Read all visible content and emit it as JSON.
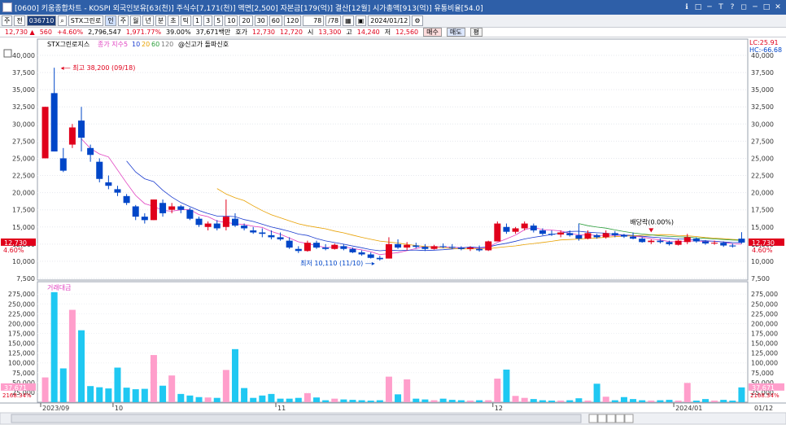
{
  "window": {
    "title": "[0600] 키움종합차트 - KOSPI 외국인보유[63(천)] 주식수[7,171(천)] 액면[2,500] 자본금[179(억)] 결산[12월] 시가총액[913(억)] 유통비율[54.0]",
    "buttons": [
      "ℹ",
      "□",
      "─",
      "T",
      "?",
      "◻",
      "─",
      "□",
      "✕"
    ]
  },
  "toolbar": {
    "period": "주",
    "mode": "전",
    "code": "036710",
    "stock_name": "STX그린로",
    "sel_label": "인",
    "tabs": [
      "주",
      "월",
      "년",
      "분",
      "초",
      "틱"
    ],
    "minutes": [
      "1",
      "3",
      "5",
      "10",
      "20",
      "30",
      "60",
      "120"
    ],
    "count": "78",
    "count_total": "/78",
    "date": "2024/01/12"
  },
  "quote": {
    "price": "12,730 ▲",
    "change": "560",
    "change_pct": "+4.60%",
    "volume": "2,796,547",
    "volume2": "1,971.77%",
    "ratio": "39.00%",
    "amount": "37,671백만",
    "hoga_label": "호가",
    "ask": "12,730",
    "bid": "12,720",
    "open_label": "시",
    "open": "13,300",
    "high_label": "고",
    "high": "14,240",
    "low_label": "저",
    "low": "12,560",
    "buy_label": "매수",
    "sell_label": "매도",
    "extra_label": "평"
  },
  "legend": {
    "name": "STX그린로지스",
    "ma_label": "종가 지수",
    "ma": [
      "5",
      "10",
      "20",
      "60",
      "120"
    ],
    "ma_colors": [
      "#e040c0",
      "#1c3dcf",
      "#e8a000",
      "#2a9d3a",
      "#777777"
    ],
    "signal": "@신고가 돌파신호"
  },
  "annotations": {
    "high": "최고 38,200 (09/18)",
    "low": "최저 10,110 (11/10)",
    "event": "배당락(0.00%)",
    "lc": "LC:25.91",
    "hc": "HC:-66.68"
  },
  "price_axis": {
    "labels": [
      "40,000",
      "37,500",
      "35,000",
      "32,500",
      "30,000",
      "27,500",
      "25,000",
      "22,500",
      "20,000",
      "17,500",
      "15,000",
      "12,500",
      "10,000",
      "7,500"
    ],
    "current": "12,730",
    "current_pct": "4.60%"
  },
  "volume_axis": {
    "title": "거래대금",
    "labels": [
      "275,000",
      "250,000",
      "225,000",
      "200,000",
      "175,000",
      "150,000",
      "125,000",
      "100,000",
      "75,000",
      "50,000",
      "25,000"
    ],
    "current": "37,671",
    "current_pct": "2168.34%"
  },
  "date_axis": {
    "labels": [
      "2023/09",
      "10",
      "11",
      "12",
      "2024/01"
    ],
    "right": "01/12"
  },
  "chart_data": {
    "type": "candlestick",
    "ylim": [
      7500,
      40000
    ],
    "candles": [
      {
        "o": 25000,
        "h": 32500,
        "l": 25000,
        "c": 32500,
        "v": 63000
      },
      {
        "o": 34500,
        "h": 38200,
        "l": 26000,
        "c": 26000,
        "v": 280000
      },
      {
        "o": 25000,
        "h": 26500,
        "l": 23000,
        "c": 23200,
        "v": 86000
      },
      {
        "o": 27000,
        "h": 30000,
        "l": 26500,
        "c": 29500,
        "v": 235000
      },
      {
        "o": 30500,
        "h": 32500,
        "l": 26000,
        "c": 28000,
        "v": 183000
      },
      {
        "o": 26500,
        "h": 27000,
        "l": 24500,
        "c": 25500,
        "v": 41000
      },
      {
        "o": 24500,
        "h": 25000,
        "l": 21500,
        "c": 22000,
        "v": 38000
      },
      {
        "o": 21500,
        "h": 22500,
        "l": 20500,
        "c": 21000,
        "v": 35000
      },
      {
        "o": 20500,
        "h": 21000,
        "l": 19500,
        "c": 20000,
        "v": 88000
      },
      {
        "o": 19500,
        "h": 19800,
        "l": 18200,
        "c": 18500,
        "v": 37000
      },
      {
        "o": 18000,
        "h": 18200,
        "l": 16000,
        "c": 16500,
        "v": 33000
      },
      {
        "o": 16500,
        "h": 17000,
        "l": 15500,
        "c": 16000,
        "v": 34000
      },
      {
        "o": 16000,
        "h": 19000,
        "l": 16000,
        "c": 19000,
        "v": 120000
      },
      {
        "o": 18500,
        "h": 19000,
        "l": 16500,
        "c": 17000,
        "v": 42000
      },
      {
        "o": 17500,
        "h": 18500,
        "l": 17000,
        "c": 18000,
        "v": 68000
      },
      {
        "o": 18000,
        "h": 18200,
        "l": 17000,
        "c": 17500,
        "v": 21000
      },
      {
        "o": 17500,
        "h": 17800,
        "l": 16000,
        "c": 16200,
        "v": 17000
      },
      {
        "o": 16200,
        "h": 16500,
        "l": 15000,
        "c": 15300,
        "v": 13000
      },
      {
        "o": 15000,
        "h": 15800,
        "l": 14500,
        "c": 15500,
        "v": 12000
      },
      {
        "o": 15500,
        "h": 16000,
        "l": 14500,
        "c": 14800,
        "v": 11000
      },
      {
        "o": 15000,
        "h": 19000,
        "l": 14500,
        "c": 16500,
        "v": 82000
      },
      {
        "o": 16200,
        "h": 17000,
        "l": 15000,
        "c": 15200,
        "v": 135000
      },
      {
        "o": 15200,
        "h": 15500,
        "l": 14500,
        "c": 14800,
        "v": 36000
      },
      {
        "o": 14500,
        "h": 15000,
        "l": 14000,
        "c": 14200,
        "v": 11000
      },
      {
        "o": 14200,
        "h": 14800,
        "l": 13500,
        "c": 14000,
        "v": 17000
      },
      {
        "o": 13800,
        "h": 14500,
        "l": 13200,
        "c": 13500,
        "v": 21000
      },
      {
        "o": 13500,
        "h": 14200,
        "l": 13000,
        "c": 13200,
        "v": 9000
      },
      {
        "o": 13000,
        "h": 13500,
        "l": 11800,
        "c": 12000,
        "v": 9000
      },
      {
        "o": 11800,
        "h": 12200,
        "l": 11200,
        "c": 11500,
        "v": 11000
      },
      {
        "o": 11500,
        "h": 13000,
        "l": 11400,
        "c": 12700,
        "v": 23000
      },
      {
        "o": 12700,
        "h": 13000,
        "l": 11800,
        "c": 12000,
        "v": 12000
      },
      {
        "o": 12000,
        "h": 12500,
        "l": 11600,
        "c": 11800,
        "v": 5000
      },
      {
        "o": 11800,
        "h": 12600,
        "l": 11700,
        "c": 12400,
        "v": 9000
      },
      {
        "o": 12200,
        "h": 12500,
        "l": 11600,
        "c": 11800,
        "v": 7000
      },
      {
        "o": 11800,
        "h": 12000,
        "l": 11200,
        "c": 11300,
        "v": 6000
      },
      {
        "o": 11300,
        "h": 11600,
        "l": 10800,
        "c": 11000,
        "v": 5000
      },
      {
        "o": 11000,
        "h": 11300,
        "l": 10400,
        "c": 10500,
        "v": 4000
      },
      {
        "o": 10500,
        "h": 10800,
        "l": 10110,
        "c": 10300,
        "v": 5000
      },
      {
        "o": 10400,
        "h": 13500,
        "l": 10400,
        "c": 12500,
        "v": 65000
      },
      {
        "o": 12500,
        "h": 13200,
        "l": 11800,
        "c": 12000,
        "v": 20000
      },
      {
        "o": 12000,
        "h": 12800,
        "l": 11600,
        "c": 12400,
        "v": 58000
      },
      {
        "o": 12300,
        "h": 12700,
        "l": 11900,
        "c": 12100,
        "v": 9000
      },
      {
        "o": 12100,
        "h": 12500,
        "l": 11500,
        "c": 11800,
        "v": 7000
      },
      {
        "o": 11800,
        "h": 12400,
        "l": 11700,
        "c": 12200,
        "v": 5000
      },
      {
        "o": 12200,
        "h": 12600,
        "l": 11900,
        "c": 12100,
        "v": 9000
      },
      {
        "o": 12100,
        "h": 12500,
        "l": 11800,
        "c": 12000,
        "v": 6000
      },
      {
        "o": 12000,
        "h": 12200,
        "l": 11600,
        "c": 11800,
        "v": 5000
      },
      {
        "o": 11800,
        "h": 12200,
        "l": 11500,
        "c": 12000,
        "v": 4000
      },
      {
        "o": 11800,
        "h": 12300,
        "l": 11400,
        "c": 11600,
        "v": 5000
      },
      {
        "o": 11600,
        "h": 13000,
        "l": 11500,
        "c": 12900,
        "v": 5000
      },
      {
        "o": 12900,
        "h": 15800,
        "l": 12900,
        "c": 15500,
        "v": 60000
      },
      {
        "o": 15000,
        "h": 15500,
        "l": 14000,
        "c": 14300,
        "v": 83000
      },
      {
        "o": 14300,
        "h": 15000,
        "l": 14000,
        "c": 14800,
        "v": 16000
      },
      {
        "o": 14800,
        "h": 15800,
        "l": 14500,
        "c": 15500,
        "v": 11000
      },
      {
        "o": 15200,
        "h": 15500,
        "l": 14200,
        "c": 14500,
        "v": 8000
      },
      {
        "o": 14500,
        "h": 14800,
        "l": 13800,
        "c": 14000,
        "v": 5000
      },
      {
        "o": 14000,
        "h": 14500,
        "l": 13700,
        "c": 13900,
        "v": 4000
      },
      {
        "o": 13900,
        "h": 14500,
        "l": 13500,
        "c": 14200,
        "v": 4000
      },
      {
        "o": 14100,
        "h": 14500,
        "l": 13600,
        "c": 13800,
        "v": 5000
      },
      {
        "o": 13800,
        "h": 15500,
        "l": 13000,
        "c": 13300,
        "v": 10000
      },
      {
        "o": 13300,
        "h": 14500,
        "l": 13200,
        "c": 14100,
        "v": 4000
      },
      {
        "o": 13800,
        "h": 14000,
        "l": 13300,
        "c": 13500,
        "v": 47000
      },
      {
        "o": 13500,
        "h": 14500,
        "l": 13300,
        "c": 14100,
        "v": 14000
      },
      {
        "o": 14100,
        "h": 14400,
        "l": 13500,
        "c": 13800,
        "v": 5000
      },
      {
        "o": 13800,
        "h": 14000,
        "l": 13400,
        "c": 13600,
        "v": 13000
      },
      {
        "o": 13600,
        "h": 14200,
        "l": 13200,
        "c": 13300,
        "v": 8000
      },
      {
        "o": 13300,
        "h": 13500,
        "l": 12700,
        "c": 12800,
        "v": 5000
      },
      {
        "o": 12800,
        "h": 13200,
        "l": 12500,
        "c": 13000,
        "v": 4000
      },
      {
        "o": 13000,
        "h": 13300,
        "l": 12600,
        "c": 12800,
        "v": 5000
      },
      {
        "o": 12800,
        "h": 13000,
        "l": 12300,
        "c": 12500,
        "v": 6000
      },
      {
        "o": 12400,
        "h": 13200,
        "l": 12300,
        "c": 13000,
        "v": 4000
      },
      {
        "o": 12800,
        "h": 14000,
        "l": 12500,
        "c": 13500,
        "v": 49000
      },
      {
        "o": 13300,
        "h": 13500,
        "l": 12700,
        "c": 12900,
        "v": 4000
      },
      {
        "o": 12900,
        "h": 13100,
        "l": 12400,
        "c": 12600,
        "v": 8000
      },
      {
        "o": 12600,
        "h": 13000,
        "l": 12400,
        "c": 12700,
        "v": 4000
      },
      {
        "o": 12700,
        "h": 12900,
        "l": 12100,
        "c": 12300,
        "v": 6000
      },
      {
        "o": 12300,
        "h": 12600,
        "l": 12000,
        "c": 12170,
        "v": 4000
      },
      {
        "o": 13300,
        "h": 14240,
        "l": 12560,
        "c": 12730,
        "v": 37671
      }
    ]
  }
}
